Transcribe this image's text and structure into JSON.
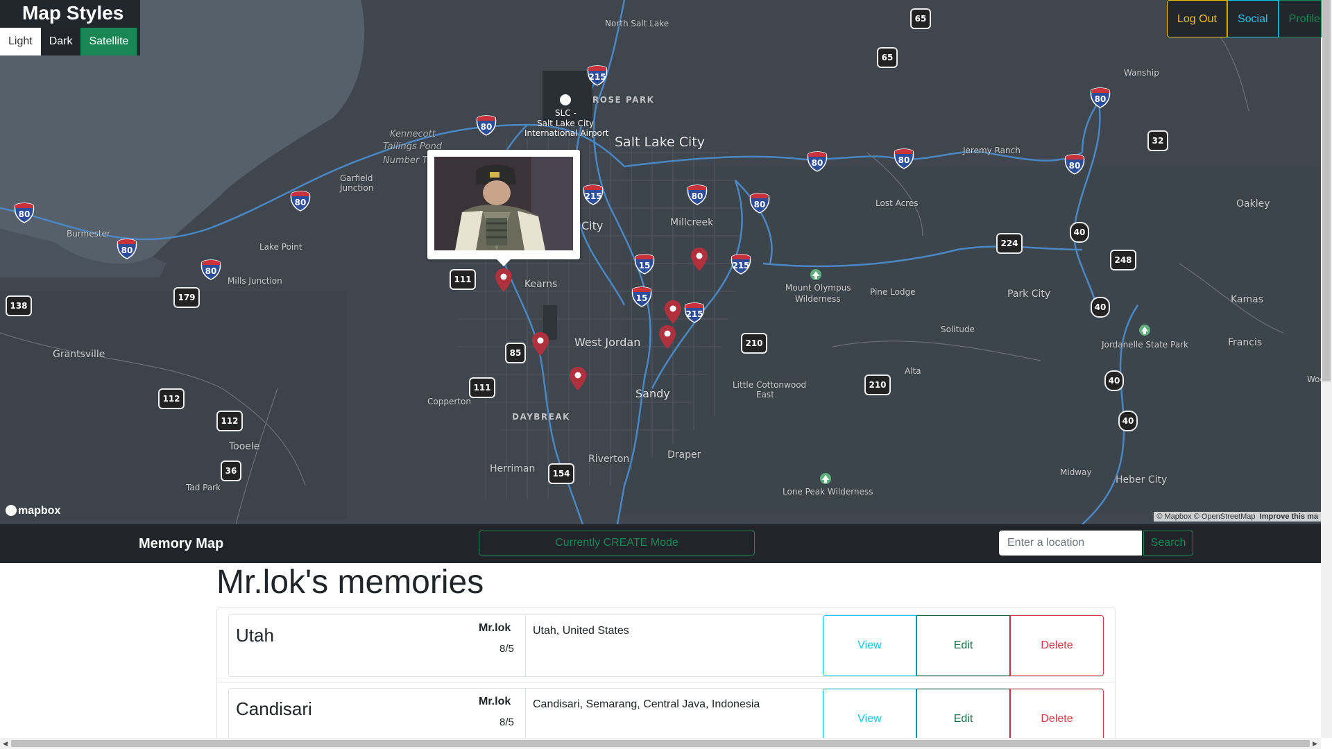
{
  "map_styles": {
    "title": "Map Styles",
    "options": [
      "Light",
      "Dark",
      "Satellite"
    ],
    "active": "Satellite"
  },
  "topnav": {
    "logout": "Log Out",
    "social": "Social",
    "profile": "Profile"
  },
  "map": {
    "labels": {
      "north_salt_lake": "North Salt Lake",
      "rose_park": "ROSE PARK",
      "airport_code": "SLC -",
      "airport_name1": "Salt Lake City",
      "airport_name2": "International Airport",
      "salt_lake_city": "Salt Lake City",
      "kennecott1": "Kennecott",
      "kennecott2": "Tailings Pond",
      "kennecott3": "Number T",
      "garfield1": "Garfield",
      "garfield2": "Junction",
      "burmester": "Burmester",
      "lake_point": "Lake Point",
      "mills_junction": "Mills Junction",
      "grantsville": "Grantsville",
      "tooele": "Tooele",
      "tad_park": "Tad Park",
      "kearns": "Kearns",
      "city": "City",
      "millcreek": "Millcreek",
      "west_jordan": "West Jordan",
      "copperton": "Copperton",
      "daybreak": "DAYBREAK",
      "sandy": "Sandy",
      "herriman": "Herriman",
      "riverton": "Riverton",
      "draper": "Draper",
      "little_cottonwood1": "Little Cottonwood",
      "little_cottonwood2": "East",
      "mount_olympus1": "Mount Olympus",
      "mount_olympus2": "Wilderness",
      "pine_lodge": "Pine Lodge",
      "lost_acres": "Lost Acres",
      "jeremy_ranch": "Jeremy Ranch",
      "wanship": "Wanship",
      "oakley": "Oakley",
      "park_city": "Park City",
      "kamas": "Kamas",
      "solitude": "Solitude",
      "alta": "Alta",
      "jordanelle": "Jordanelle State Park",
      "francis": "Francis",
      "midway": "Midway",
      "heber_city": "Heber City",
      "lone_peak": "Lone Peak Wilderness",
      "woo": "Woo"
    },
    "shields": {
      "i215_a": "215",
      "i80_a": "80",
      "i80_b": "80",
      "i80_c": "80",
      "i80_d": "80",
      "i80_e": "80",
      "i80_f": "80",
      "i80_g": "80",
      "i80_h": "80",
      "i80_i": "80",
      "i80_j": "80",
      "i80_k": "80",
      "i215_b": "215",
      "i215_c": "215",
      "i215_d": "215",
      "i15_a": "15",
      "i15_b": "15"
    },
    "state_shields": {
      "s65a": "65",
      "s65b": "65",
      "s32": "32",
      "s224": "224",
      "s248": "248",
      "s40a": "40",
      "s40b": "40",
      "s40c": "40",
      "s40d": "40",
      "s111a": "111",
      "s111b": "111",
      "s85": "85",
      "s138": "138",
      "s179": "179",
      "s112a": "112",
      "s112b": "112",
      "s36": "36",
      "s154": "154",
      "s210a": "210",
      "s210b": "210"
    },
    "mapbox_logo": "mapbox",
    "attribution": "© Mapbox © OpenStreetMap",
    "improve": "Improve this ma"
  },
  "navbar": {
    "brand": "Memory Map",
    "mode": "Currently CREATE Mode",
    "search_placeholder": "Enter a location",
    "search_button": "Search"
  },
  "page": {
    "title": "Mr.lok's memories"
  },
  "memories": [
    {
      "name": "Utah",
      "user": "Mr.lok",
      "date": "8/5",
      "address": "Utah, United States",
      "view": "View",
      "edit": "Edit",
      "delete": "Delete"
    },
    {
      "name": "Candisari",
      "user": "Mr.lok",
      "date": "8/5",
      "address": "Candisari, Semarang, Central Java, Indonesia",
      "view": "View",
      "edit": "Edit",
      "delete": "Delete"
    }
  ],
  "colors": {
    "map_bg": "#3f464e",
    "lake": "#56606a",
    "road_highway": "#4b87c4",
    "pin": "#b0313e",
    "success": "#198754",
    "info": "#0dcaf0",
    "warning": "#ffc107",
    "danger": "#dc3545"
  },
  "icons": {
    "pin": "map-pin-icon",
    "airport": "airplane-icon",
    "park": "park-tree-icon",
    "mapbox": "mapbox-logo-icon"
  }
}
